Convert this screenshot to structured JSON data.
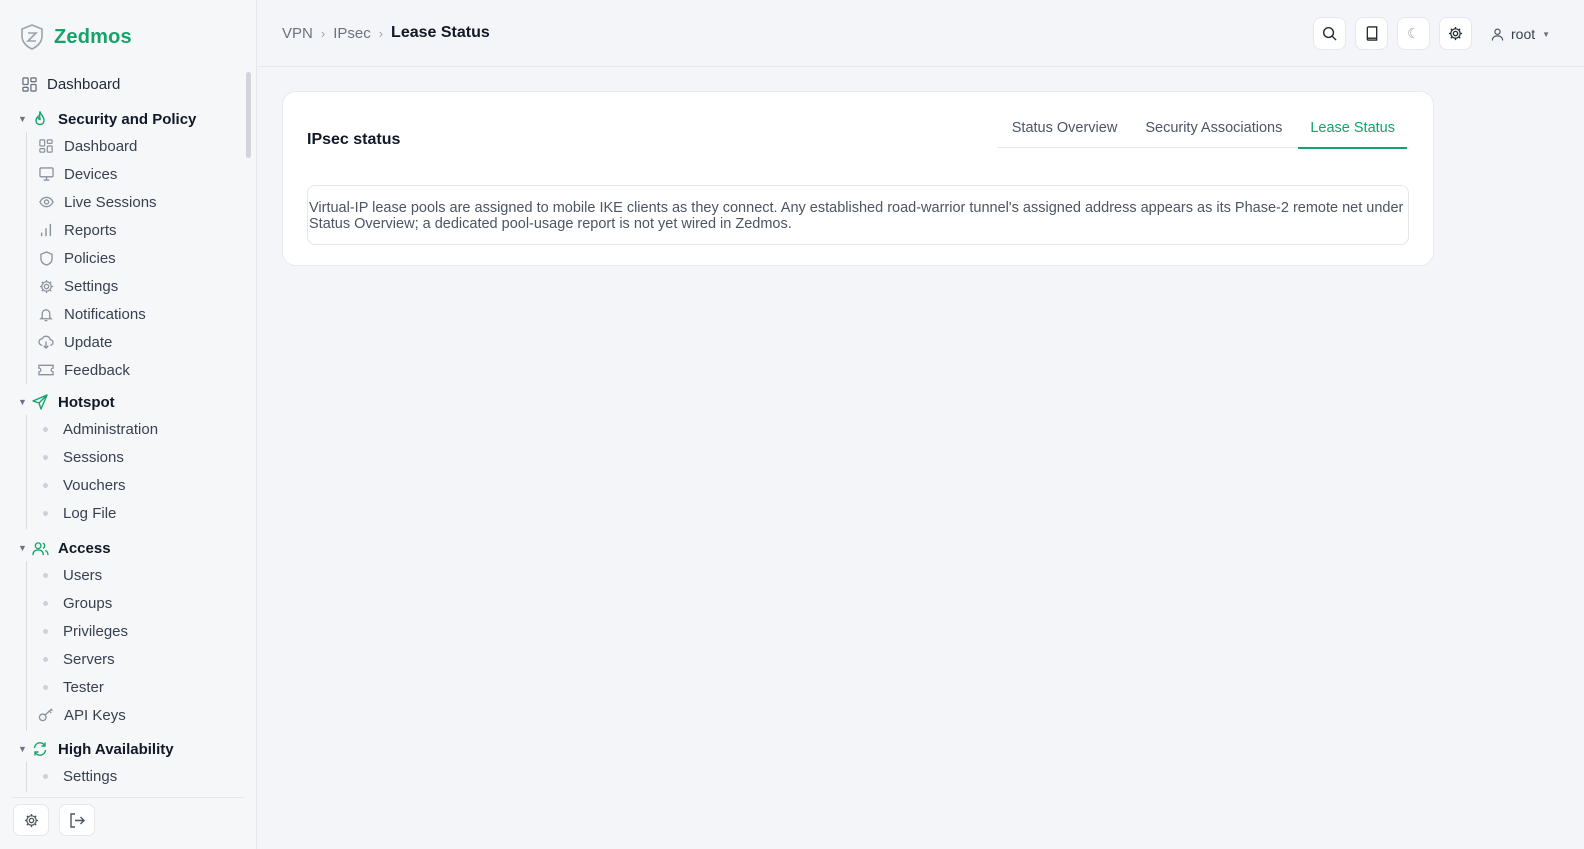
{
  "app": {
    "name": "Zedmos"
  },
  "colors": {
    "accent": "#16a36a",
    "text": "#1f2937",
    "muted": "#6b7280"
  },
  "sidebar": {
    "top_item": {
      "label": "Dashboard",
      "icon": "dashboard-icon"
    },
    "sections": [
      {
        "title": "Security and Policy",
        "icon": "flame-icon",
        "items": [
          {
            "label": "Dashboard",
            "icon": "dashboard-icon"
          },
          {
            "label": "Devices",
            "icon": "monitor-icon"
          },
          {
            "label": "Live Sessions",
            "icon": "eye-icon"
          },
          {
            "label": "Reports",
            "icon": "bar-chart-icon"
          },
          {
            "label": "Policies",
            "icon": "shield-icon"
          },
          {
            "label": "Settings",
            "icon": "gear-icon"
          },
          {
            "label": "Notifications",
            "icon": "bell-icon"
          },
          {
            "label": "Update",
            "icon": "cloud-download-icon"
          },
          {
            "label": "Feedback",
            "icon": "ticket-icon"
          }
        ]
      },
      {
        "title": "Hotspot",
        "icon": "send-icon",
        "items": [
          {
            "label": "Administration"
          },
          {
            "label": "Sessions"
          },
          {
            "label": "Vouchers"
          },
          {
            "label": "Log File"
          }
        ]
      },
      {
        "title": "Access",
        "icon": "users-icon",
        "items": [
          {
            "label": "Users"
          },
          {
            "label": "Groups"
          },
          {
            "label": "Privileges"
          },
          {
            "label": "Servers"
          },
          {
            "label": "Tester"
          },
          {
            "label": "API Keys",
            "icon": "key-icon"
          }
        ]
      },
      {
        "title": "High Availability",
        "icon": "refresh-icon",
        "items": [
          {
            "label": "Settings"
          }
        ]
      }
    ]
  },
  "header": {
    "breadcrumb": [
      "VPN",
      "IPsec",
      "Lease Status"
    ],
    "user": "root"
  },
  "card": {
    "title": "IPsec status",
    "tabs": [
      "Status Overview",
      "Security Associations",
      "Lease Status"
    ],
    "active_tab": "Lease Status",
    "notice": "Virtual-IP lease pools are assigned to mobile IKE clients as they connect. Any established road-warrior tunnel's assigned address appears as its Phase-2 remote net under Status Overview; a dedicated pool-usage report is not yet wired in Zedmos."
  }
}
